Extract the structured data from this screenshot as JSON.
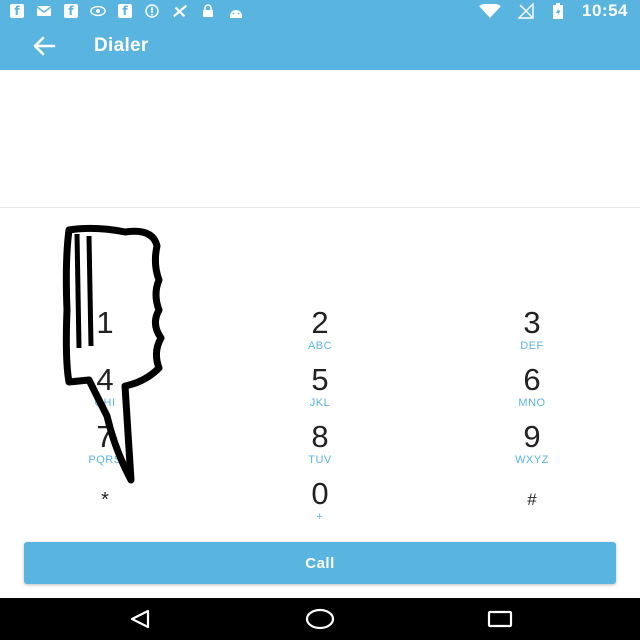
{
  "status_bar": {
    "time": "10:54",
    "icons": [
      "facebook-icon",
      "message-icon",
      "facebook-icon",
      "eye-icon",
      "facebook-icon",
      "info-icon",
      "app-icon",
      "lock-icon",
      "android-icon",
      "wifi-icon",
      "no-signal-icon",
      "battery-charging-icon"
    ]
  },
  "app_bar": {
    "title": "Dialer",
    "back_icon": "arrow-back-icon"
  },
  "display": {
    "number": ""
  },
  "keypad": {
    "keys": [
      {
        "digit": "1",
        "letters": ""
      },
      {
        "digit": "2",
        "letters": "ABC"
      },
      {
        "digit": "3",
        "letters": "DEF"
      },
      {
        "digit": "4",
        "letters": "GHI"
      },
      {
        "digit": "5",
        "letters": "JKL"
      },
      {
        "digit": "6",
        "letters": "MNO"
      },
      {
        "digit": "7",
        "letters": "PQRS"
      },
      {
        "digit": "8",
        "letters": "TUV"
      },
      {
        "digit": "9",
        "letters": "WXYZ"
      },
      {
        "digit": "*",
        "letters": ""
      },
      {
        "digit": "0",
        "letters": "+"
      },
      {
        "digit": "#",
        "letters": ""
      }
    ]
  },
  "call_button": {
    "label": "Call"
  },
  "nav_bar": {
    "icons": [
      "back-triangle-icon",
      "home-circle-icon",
      "recents-square-icon"
    ]
  },
  "colors": {
    "accent": "#5ab4e0",
    "nav_background": "#000000"
  }
}
